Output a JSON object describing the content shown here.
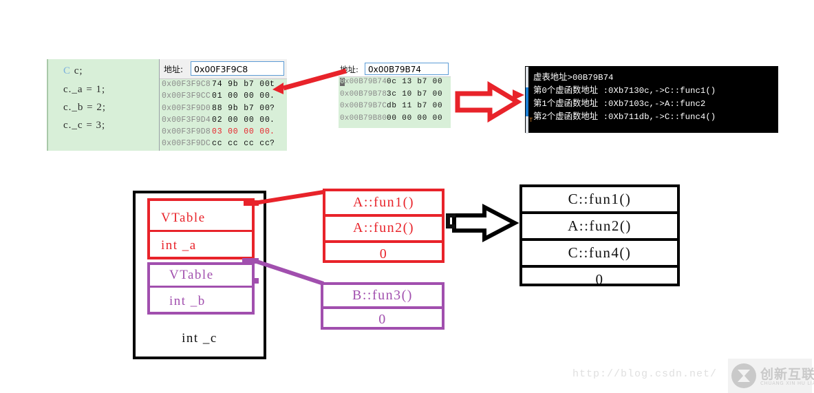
{
  "code_pane": {
    "lines": [
      {
        "type_token": "C",
        "rest": " c;"
      },
      {
        "type_token": "",
        "rest": "c._a = 1;"
      },
      {
        "type_token": "",
        "rest": "c._b = 2;"
      },
      {
        "type_token": "",
        "rest": "c._c = 3;"
      }
    ]
  },
  "memory_window_1": {
    "address_label": "地址:",
    "address_value": "0x00F3F9C8",
    "rows": [
      {
        "addr": "0x00F3F9C8",
        "bytes": "74 9b b7 00",
        "ascii": "t",
        "highlight": false
      },
      {
        "addr": "0x00F3F9CC",
        "bytes": "01 00 00 00",
        "ascii": ".",
        "highlight": false
      },
      {
        "addr": "0x00F3F9D0",
        "bytes": "88 9b b7 00",
        "ascii": "?",
        "highlight": false
      },
      {
        "addr": "0x00F3F9D4",
        "bytes": "02 00 00 00",
        "ascii": ".",
        "highlight": false
      },
      {
        "addr": "0x00F3F9D8",
        "bytes": "03 00 00 00",
        "ascii": ".",
        "highlight": true
      },
      {
        "addr": "0x00F3F9DC",
        "bytes": "cc cc cc cc",
        "ascii": "?",
        "highlight": false
      }
    ]
  },
  "memory_window_2": {
    "address_label": "地址:",
    "address_value": "0x00B79B74",
    "rows": [
      {
        "addr": "0x00B79B74",
        "bytes": "0c 13 b7 00",
        "selected": true
      },
      {
        "addr": "0x00B79B78",
        "bytes": "3c 10 b7 00",
        "selected": false
      },
      {
        "addr": "0x00B79B7C",
        "bytes": "db 11 b7 00",
        "selected": false
      },
      {
        "addr": "0x00B79B80",
        "bytes": "00 00 00 00",
        "selected": false
      }
    ]
  },
  "console": {
    "lines": [
      "虚表地址>00B79B74",
      "第0个虚函数地址 :0Xb7130c,->C::func1()",
      "第1个虚函数地址 :0Xb7103c,->A::func2",
      "第2个虚函数地址 :0Xb711db,->C::func4()"
    ],
    "prompt_char": "T"
  },
  "object_layout": {
    "base_a": {
      "vtable": "VTable",
      "member": "int _a"
    },
    "base_b": {
      "vtable": "VTable",
      "member": "int _b"
    },
    "own_member": "int _c"
  },
  "vtable_a": {
    "entries": [
      "A::fun1()",
      "A::fun2()",
      "0"
    ]
  },
  "vtable_b": {
    "entries": [
      "B::fun3()",
      "0"
    ]
  },
  "vtable_merged": {
    "entries": [
      "C::fun1()",
      "A::fun2()",
      "C::fun4()",
      "0"
    ]
  },
  "watermark": {
    "url": "http://blog.csdn.net/",
    "logo_cn": "创新互联",
    "logo_en": "CHUANG XIN HU LIAN"
  },
  "colors": {
    "red": "#e8232a",
    "purple": "#a14fae",
    "black": "#111111",
    "code_bg": "#d8efd8",
    "console_bg": "#000000",
    "accent_blue": "#1e7fd4"
  }
}
